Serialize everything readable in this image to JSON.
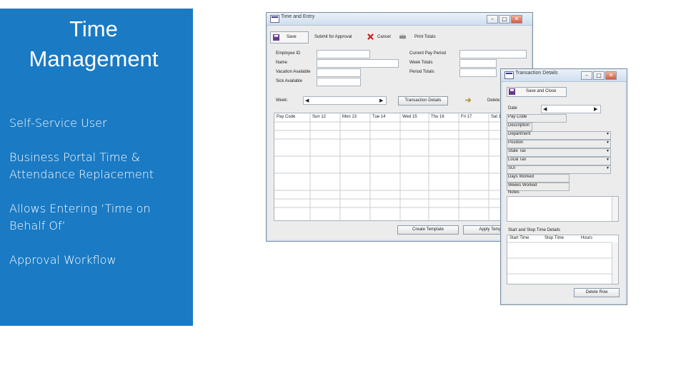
{
  "slide": {
    "title_line1": "Time",
    "title_line2": "Management",
    "bullets": [
      "Self-Service User",
      "Business Portal Time & Attendance Replacement",
      "Allows Entering ‘Time on Behalf Of’",
      "Approval Workflow"
    ]
  },
  "colors": {
    "panel": "#1a7ac4",
    "panel_text": "#ffffff"
  },
  "time_entry_window": {
    "title": "Time and Entry",
    "controls": [
      "–",
      "□",
      "✕"
    ],
    "toolbar": {
      "save": "Save",
      "submit": "Submit for Approval",
      "cancel": "Cancel",
      "print": "Print Totals"
    },
    "labels": {
      "employee_id": "Employee ID",
      "name": "Name",
      "vacation": "Vacation Available",
      "sick": "Sick Available",
      "current_period": "Current Pay Period",
      "weekly": "Week Totals",
      "period_totals": "Period Totals",
      "week": "Week:"
    },
    "buttons": {
      "transaction_details": "Transaction Details",
      "delete": "Delete",
      "create_template": "Create Template",
      "apply_template": "Apply Template"
    },
    "grid_headers": [
      "Pay Code",
      "Sun 12",
      "Mon 13",
      "Tue 14",
      "Wed 15",
      "Thu 16",
      "Fri 17",
      "Sat 18"
    ]
  },
  "transaction_window": {
    "title": "Transaction Details",
    "save_close": "Save and Close",
    "labels": [
      "Date",
      "Pay Code",
      "Description",
      "Department",
      "Position",
      "State Tax",
      "Local Tax",
      "SUI",
      "Days Worked",
      "Weeks Worked"
    ],
    "notes_label": "Notes",
    "shift_section": "Start and Stop Time Details",
    "shift_headers": [
      "Start Time",
      "Stop Time",
      "Hours"
    ],
    "delete_row": "Delete Row"
  }
}
